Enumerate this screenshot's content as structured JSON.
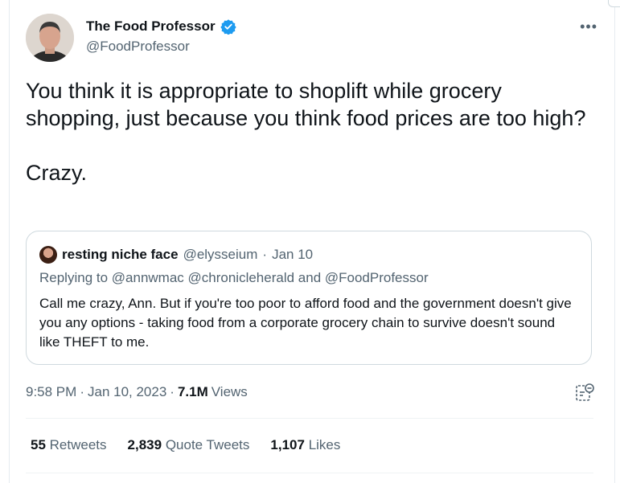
{
  "author": {
    "name": "The Food Professor",
    "handle": "@FoodProfessor"
  },
  "tweet": {
    "text": "You think it is appropriate to shoplift while grocery shopping, just because you think food prices are too high?\n\nCrazy."
  },
  "quote": {
    "name": "resting niche face",
    "handle": "@elysseium",
    "separator": "·",
    "date": "Jan 10",
    "replying_to": "Replying to @annwmac @chronicleherald and @FoodProfessor",
    "text": "Call me crazy, Ann. But if you're too poor to afford food and the government doesn't give you any options - taking food from a corporate grocery chain to survive doesn't sound like THEFT to me."
  },
  "meta": {
    "time": "9:58 PM",
    "sep1": "·",
    "date": "Jan 10, 2023",
    "sep2": "·",
    "views_count": "7.1M",
    "views_label": "Views"
  },
  "stats": {
    "retweets_count": "55",
    "retweets_label": "Retweets",
    "quotes_count": "2,839",
    "quotes_label": "Quote Tweets",
    "likes_count": "1,107",
    "likes_label": "Likes"
  },
  "more_label": "•••",
  "colors": {
    "text": "#0f1419",
    "secondary": "#536471",
    "verified": "#1d9bf0",
    "border": "#cfd9de"
  },
  "icons": [
    "verified-badge-icon",
    "more-options-icon",
    "analytics-icon"
  ]
}
